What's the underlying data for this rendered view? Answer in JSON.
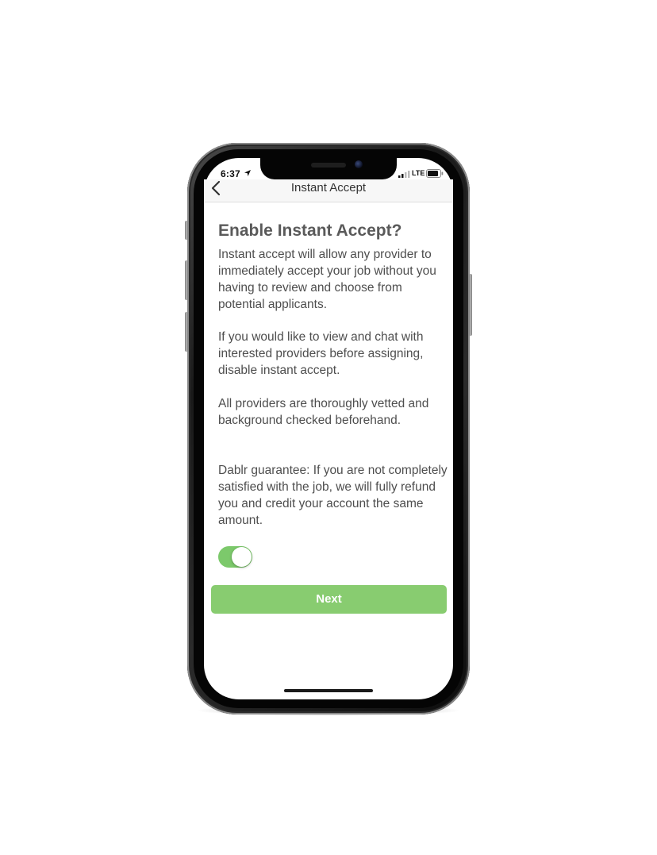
{
  "status_bar": {
    "time": "6:37",
    "network": "LTE",
    "icons": [
      "location-arrow-icon",
      "signal-bars-icon",
      "battery-icon"
    ]
  },
  "nav": {
    "back_icon": "chevron-left-icon",
    "title": "Instant Accept"
  },
  "content": {
    "heading": "Enable Instant Accept?",
    "paragraph_1": "Instant accept will allow any provider to immediately accept your job without you having to review and choose from potential applicants.",
    "paragraph_2": "If you would like to view and chat with interested providers before assigning, disable instant accept.",
    "paragraph_3": "All providers are thoroughly vetted and background checked beforehand.",
    "paragraph_4": "Dablr guarantee: If you are not completely satisfied with the job, we will fully refund you and credit your account the same amount."
  },
  "toggle": {
    "state": "on",
    "on_color": "#7cc96b"
  },
  "next_button": {
    "label": "Next",
    "color": "#88cc70"
  }
}
